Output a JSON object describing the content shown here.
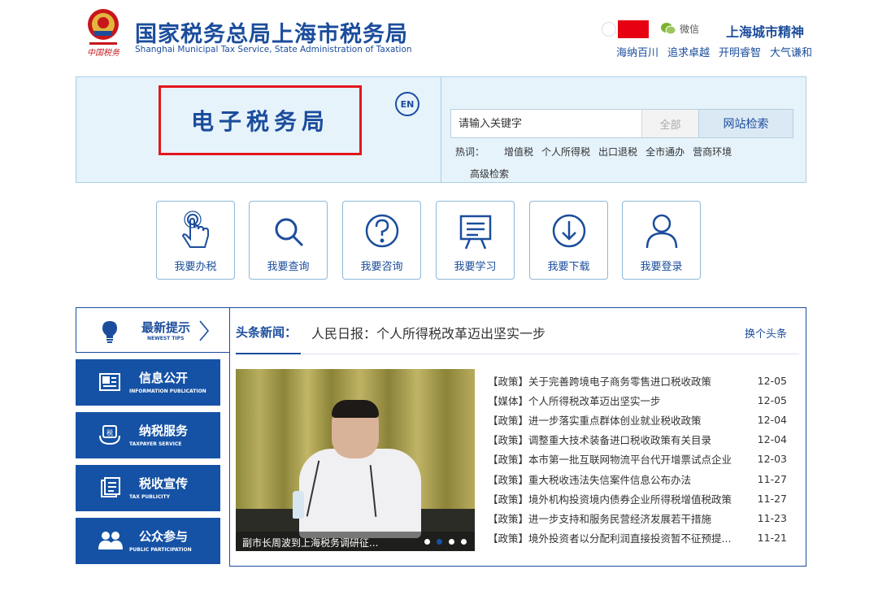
{
  "header": {
    "title": "国家税务总局上海市税务局",
    "subtitle": "Shanghai Municipal Tax Service, State Administration of Taxation",
    "wechat_label": "微信",
    "spirit_title": "上海城市精神",
    "spirit_words": [
      "海纳百川",
      "追求卓越",
      "开明睿智",
      "大气谦和"
    ]
  },
  "banner": {
    "title": "电子税务局",
    "lang_button": "EN",
    "search": {
      "placeholder": "请输入关键字",
      "scope": "全部",
      "button": "网站检索"
    },
    "hotwords_label": "热词：",
    "hotwords": [
      "增值税",
      "个人所得税",
      "出口退税",
      "全市通办",
      "营商环境"
    ],
    "advanced_search": "高级检索"
  },
  "tiles": [
    {
      "label": "我要办税",
      "icon": "hand-pointer-icon"
    },
    {
      "label": "我要查询",
      "icon": "search-icon"
    },
    {
      "label": "我要咨询",
      "icon": "question-icon"
    },
    {
      "label": "我要学习",
      "icon": "presentation-icon"
    },
    {
      "label": "我要下载",
      "icon": "download-icon"
    },
    {
      "label": "我要登录",
      "icon": "user-icon"
    }
  ],
  "sidebar": {
    "tips": {
      "label": "最新提示",
      "sublabel": "NEWEST TIPS"
    },
    "items": [
      {
        "label": "信息公开",
        "sublabel": "INFORMATION PUBLICATION",
        "icon": "newspaper-icon"
      },
      {
        "label": "纳税服务",
        "sublabel": "TAXPAYER SERVICE",
        "icon": "tax-service-icon"
      },
      {
        "label": "税收宣传",
        "sublabel": "TAX PUBLICITY",
        "icon": "document-icon"
      },
      {
        "label": "公众参与",
        "sublabel": "PUBLIC PARTICIPATION",
        "icon": "people-icon"
      }
    ]
  },
  "news": {
    "headline_label": "头条新闻：",
    "headline": "人民日报：个人所得税改革迈出坚实一步",
    "switch_label": "换个头条",
    "photo_caption": "副市长周波到上海税务调研征...",
    "slide_count": 4,
    "active_slide": 2,
    "items": [
      {
        "title": "【政策】关于完善跨境电子商务零售进口税收政策",
        "date": "12-05"
      },
      {
        "title": "【媒体】个人所得税改革迈出坚实一步",
        "date": "12-05"
      },
      {
        "title": "【政策】进一步落实重点群体创业就业税收政策",
        "date": "12-04"
      },
      {
        "title": "【政策】调整重大技术装备进口税收政策有关目录",
        "date": "12-04"
      },
      {
        "title": "【政策】本市第一批互联网物流平台代开增票试点企业",
        "date": "12-03"
      },
      {
        "title": "【政策】重大税收违法失信案件信息公布办法",
        "date": "11-27"
      },
      {
        "title": "【政策】境外机构投资境内债券企业所得税增值税政策",
        "date": "11-27"
      },
      {
        "title": "【政策】进一步支持和服务民营经济发展若干措施",
        "date": "11-23"
      },
      {
        "title": "【政策】境外投资者以分配利润直接投资暂不征预提...",
        "date": "11-21"
      }
    ]
  },
  "colors": {
    "brand_blue": "#1b4d9c",
    "nav_blue": "#1552a6",
    "highlight_red": "#e3151d",
    "banner_bg": "#e6f3fb"
  }
}
